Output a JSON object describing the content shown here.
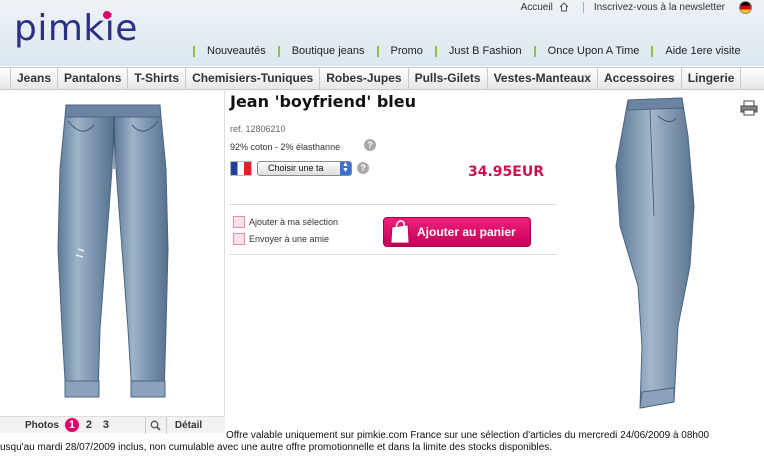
{
  "header": {
    "logo_text": "pimkie",
    "top_links": {
      "home": "Accueil",
      "newsletter": "Inscrivez-vous à la newsletter"
    },
    "main_nav": [
      "Nouveautés",
      "Boutique jeans",
      "Promo",
      "Just B Fashion",
      "Once Upon A Time",
      "Aide 1ere visite"
    ]
  },
  "categories": [
    "Jeans",
    "Pantalons",
    "T-Shirts",
    "Chemisiers-Tuniques",
    "Robes-Jupes",
    "Pulls-Gilets",
    "Vestes-Manteaux",
    "Accessoires",
    "Lingerie"
  ],
  "product": {
    "title": "Jean 'boyfriend' bleu",
    "reference": "ref. 12806210",
    "composition": "92% coton - 2% élasthanne",
    "size_select": "Choisir une ta",
    "price": "34.95EUR",
    "help": "?",
    "add_to_selection": "Ajouter à ma sélection",
    "send_to_friend": "Envoyer à une amie",
    "add_to_cart": "Ajouter au panier"
  },
  "gallery": {
    "photos_label": "Photos",
    "pages": [
      "1",
      "2",
      "3"
    ],
    "active_page": "1",
    "detail_label": "Détail"
  },
  "notice": {
    "line1": "Offre valable uniquement sur pimkie.com France sur une sélection d'articles du mercredi 24/06/2009 à 08h00",
    "line2": "usqu'au mardi 28/07/2009 inclus, non cumulable avec une autre offre promotionnelle et dans la limite des stocks disponibles."
  },
  "colors": {
    "brand_navy": "#2b2f86",
    "brand_pink": "#e3006b",
    "price_red": "#d0104c",
    "nav_separator_green": "#8cc63f",
    "cart_button": "#e0106c"
  },
  "icons": [
    "home-icon",
    "germany-flag-icon",
    "france-flag-icon",
    "help-icon",
    "select-arrow-icon",
    "zoom-icon",
    "print-icon",
    "selection-icon",
    "send-friend-icon",
    "shopping-bag-icon"
  ]
}
